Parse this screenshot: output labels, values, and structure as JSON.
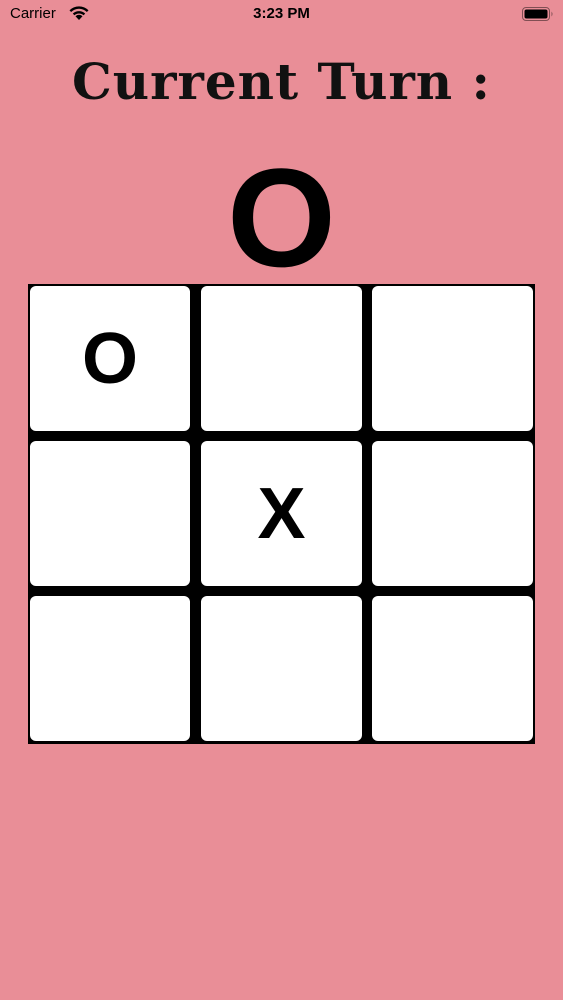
{
  "status_bar": {
    "carrier": "Carrier",
    "time": "3:23 PM",
    "wifi_icon": "wifi-icon",
    "battery_icon": "battery-icon"
  },
  "title": "Current Turn :",
  "current_turn": "O",
  "board": {
    "cells": [
      "O",
      "",
      "",
      "",
      "X",
      "",
      "",
      "",
      ""
    ]
  },
  "colors": {
    "background": "#e98e97",
    "grid": "#000000",
    "cell": "#ffffff"
  }
}
